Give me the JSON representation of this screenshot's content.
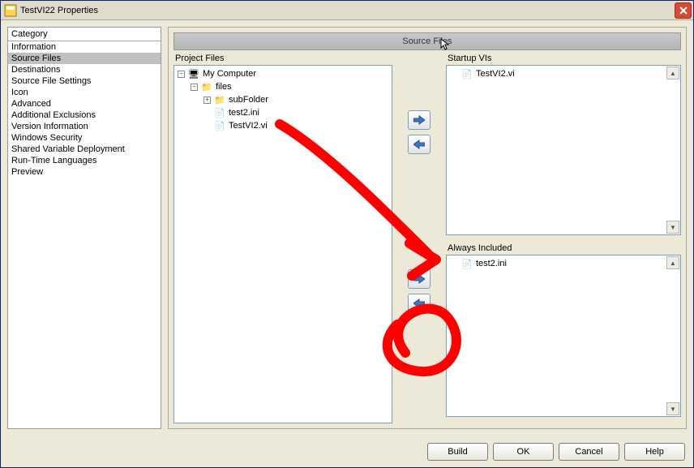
{
  "window": {
    "title": "TestVI22 Properties"
  },
  "category": {
    "header": "Category",
    "items": [
      "Information",
      "Source Files",
      "Destinations",
      "Source File Settings",
      "Icon",
      "Advanced",
      "Additional Exclusions",
      "Version Information",
      "Windows Security",
      "Shared Variable Deployment",
      "Run-Time Languages",
      "Preview"
    ],
    "selected_index": 1
  },
  "section_title": "Source Files",
  "project_files": {
    "label": "Project Files",
    "tree": [
      {
        "depth": 0,
        "expander": "-",
        "icon": "computer-icon",
        "label": "My Computer"
      },
      {
        "depth": 1,
        "expander": "-",
        "icon": "folder-icon",
        "label": "files"
      },
      {
        "depth": 2,
        "expander": "+",
        "icon": "folder-icon",
        "label": "subFolder"
      },
      {
        "depth": 2,
        "expander": "",
        "icon": "ini-icon",
        "label": "test2.ini"
      },
      {
        "depth": 2,
        "expander": "",
        "icon": "vi-icon",
        "label": "TestVI2.vi"
      }
    ]
  },
  "startup": {
    "label": "Startup VIs",
    "items": [
      {
        "icon": "vi-icon",
        "label": "TestVI2.vi"
      }
    ]
  },
  "always_included": {
    "label": "Always Included",
    "items": [
      {
        "icon": "ini-icon",
        "label": "test2.ini"
      }
    ]
  },
  "buttons": {
    "build": "Build",
    "ok": "OK",
    "cancel": "Cancel",
    "help": "Help"
  }
}
